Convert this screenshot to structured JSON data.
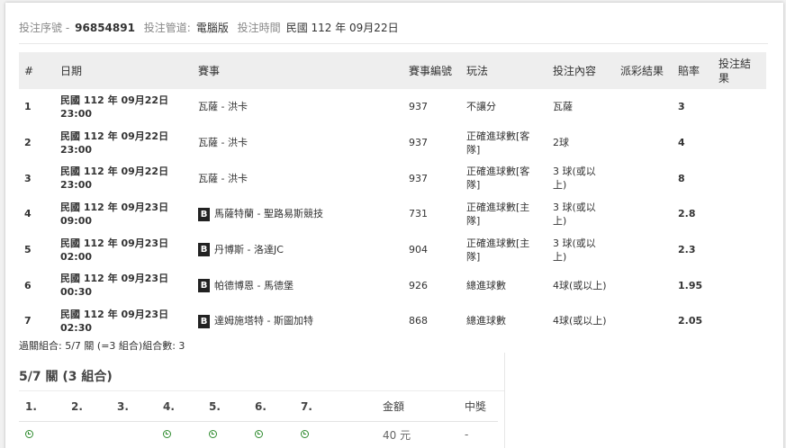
{
  "header": {
    "serial_label": "投注序號 -",
    "serial_value": "96854891",
    "channel_label": "投注管道:",
    "channel_value": "電腦版",
    "time_label": "投注時間",
    "time_value": "民國 112 年 09月22日"
  },
  "table": {
    "columns": [
      "#",
      "日期",
      "賽事",
      "賽事編號",
      "玩法",
      "投注內容",
      "派彩結果",
      "賠率",
      "投注結果"
    ],
    "rows": [
      {
        "num": "1",
        "date": "民國 112 年 09月22日",
        "time": "23:00",
        "badge": "",
        "match": "瓦薩 - 洪卡",
        "code": "937",
        "play": "不讓分",
        "pick": "瓦薩",
        "payout": "",
        "odds": "3",
        "result": ""
      },
      {
        "num": "2",
        "date": "民國 112 年 09月22日",
        "time": "23:00",
        "badge": "",
        "match": "瓦薩 - 洪卡",
        "code": "937",
        "play": "正確進球數[客隊]",
        "pick": "2球",
        "payout": "",
        "odds": "4",
        "result": ""
      },
      {
        "num": "3",
        "date": "民國 112 年 09月22日",
        "time": "23:00",
        "badge": "",
        "match": "瓦薩 - 洪卡",
        "code": "937",
        "play": "正確進球數[客隊]",
        "pick": "3 球(或以上)",
        "payout": "",
        "odds": "8",
        "result": ""
      },
      {
        "num": "4",
        "date": "民國 112 年 09月23日",
        "time": "09:00",
        "badge": "B",
        "match": "馬薩特蘭 - 聖路易斯競技",
        "code": "731",
        "play": "正確進球數[主隊]",
        "pick": "3 球(或以上)",
        "payout": "",
        "odds": "2.8",
        "result": ""
      },
      {
        "num": "5",
        "date": "民國 112 年 09月23日",
        "time": "02:00",
        "badge": "B",
        "match": "丹博斯 - 洛達JC",
        "code": "904",
        "play": "正確進球數[主隊]",
        "pick": "3 球(或以上)",
        "payout": "",
        "odds": "2.3",
        "result": ""
      },
      {
        "num": "6",
        "date": "民國 112 年 09月23日",
        "time": "00:30",
        "badge": "B",
        "match": "帕德博恩 - 馬德堡",
        "code": "926",
        "play": "總進球數",
        "pick": "4球(或以上)",
        "payout": "",
        "odds": "1.95",
        "result": ""
      },
      {
        "num": "7",
        "date": "民國 112 年 09月23日",
        "time": "02:30",
        "badge": "B",
        "match": "達姆施塔特 - 斯圖加特",
        "code": "868",
        "play": "總進球數",
        "pick": "4球(或以上)",
        "payout": "",
        "odds": "2.05",
        "result": ""
      }
    ]
  },
  "combo_summary": "過關組合: 5/7 關 (=3 組合)組合數: 3",
  "combo": {
    "title": "5/7 關 (3 組合)",
    "columns": [
      "1.",
      "2.",
      "3.",
      "4.",
      "5.",
      "6.",
      "7.",
      "金額",
      "中獎"
    ],
    "row": {
      "amount": "40 元",
      "win": "-"
    },
    "icon": "clock-icon",
    "icon_color": "#2e8b2e"
  }
}
